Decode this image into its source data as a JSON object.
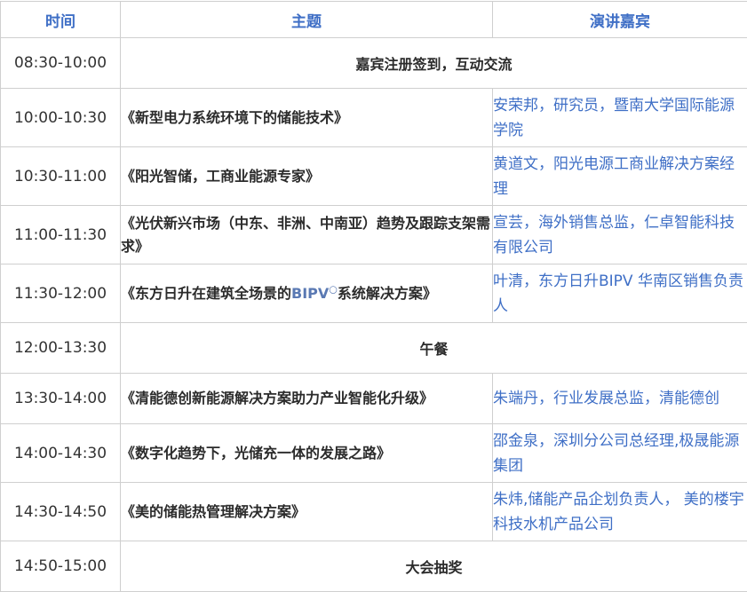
{
  "headers": {
    "time": "时间",
    "topic": "主题",
    "speaker": "演讲嘉宾"
  },
  "rows": [
    {
      "time": "08:30-10:00",
      "event": "嘉宾注册签到，互动交流"
    },
    {
      "time": "10:00-10:30",
      "topic": "《新型电力系统环境下的储能技术》",
      "speaker": "安荣邦，研究员，暨南大学国际能源学院"
    },
    {
      "time": "10:30-11:00",
      "topic": "《阳光智储，工商业能源专家》",
      "speaker": "黄道文，阳光电源工商业解决方案经理"
    },
    {
      "time": "11:00-11:30",
      "topic": "《光伏新兴市场（中东、非洲、中南亚）趋势及跟踪支架需求》",
      "speaker": "宣芸，海外销售总监，仁卓智能科技有限公司"
    },
    {
      "time": "11:30-12:00",
      "topic_before": "《东方日升在建筑全场景的",
      "topic_accent": "BIPV",
      "topic_mark": "○",
      "topic_after": "系统解决方案》",
      "speaker": "叶清，东方日升BIPV 华南区销售负责人"
    },
    {
      "time": "12:00-13:30",
      "event": "午餐"
    },
    {
      "time": "13:30-14:00",
      "topic": "《清能德创新能源解决方案助力产业智能化升级》",
      "speaker": "朱端丹，行业发展总监，清能德创"
    },
    {
      "time": "14:00-14:30",
      "topic": "《数字化趋势下，光储充一体的发展之路》",
      "speaker": "邵金泉，深圳分公司总经理,极晟能源集团"
    },
    {
      "time": "14:30-14:50",
      "topic": "《美的储能热管理解决方案》",
      "speaker": "朱炜,储能产品企划负责人， 美的楼宇科技水机产品公司"
    },
    {
      "time": "14:50-15:00",
      "event": "大会抽奖"
    }
  ]
}
